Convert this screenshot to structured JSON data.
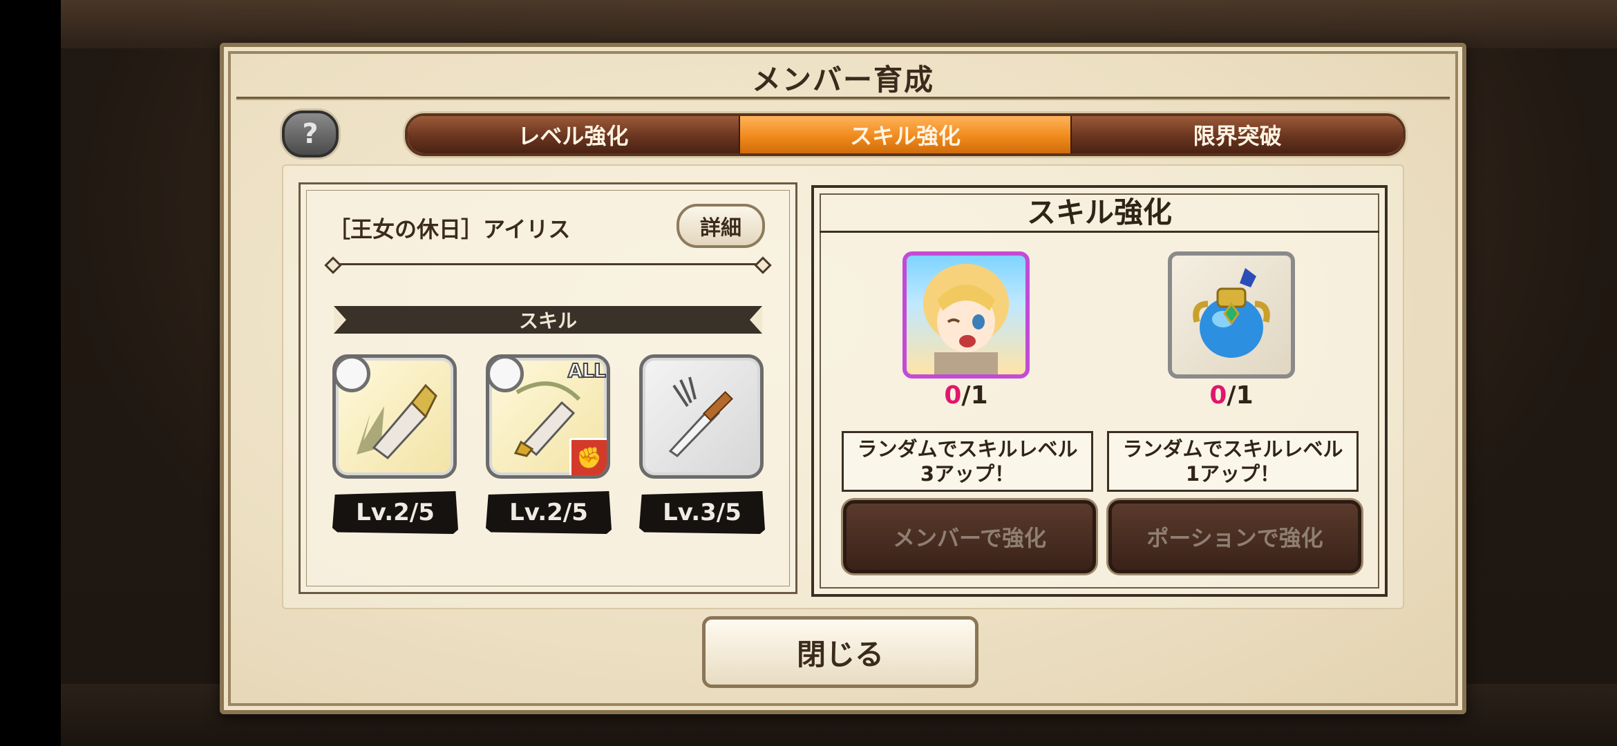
{
  "dialog": {
    "title": "メンバー育成",
    "help_label": "?"
  },
  "tabs": [
    {
      "label": "レベル強化",
      "active": false
    },
    {
      "label": "スキル強化",
      "active": true
    },
    {
      "label": "限界突破",
      "active": false
    }
  ],
  "character": {
    "name": "［王女の休日］アイリス",
    "detail_button": "詳細"
  },
  "skills": {
    "header": "スキル",
    "items": [
      {
        "level": "Lv.2/5",
        "icon": "sword-break-icon"
      },
      {
        "level": "Lv.2/5",
        "icon": "sword-slash-icon",
        "tag": "ALL",
        "badge_icon": "fist-icon"
      },
      {
        "level": "Lv.3/5",
        "icon": "dagger-icon"
      }
    ]
  },
  "enhance": {
    "title": "スキル強化",
    "member": {
      "count_zero": "0",
      "count_rest": "/1",
      "desc_line1": "ランダムでスキルレベル",
      "desc_line2": "3アップ！",
      "button": "メンバーで強化"
    },
    "potion": {
      "count_zero": "0",
      "count_rest": "/1",
      "desc_line1": "ランダムでスキルレベル",
      "desc_line2": "1アップ！",
      "button": "ポーションで強化"
    }
  },
  "nav": {
    "prev": "‹",
    "next": "›"
  },
  "close_button": "閉じる",
  "colors": {
    "tab_active": "#f08a1c",
    "tab_inactive": "#6a3520",
    "accent_pink": "#e0176c"
  }
}
